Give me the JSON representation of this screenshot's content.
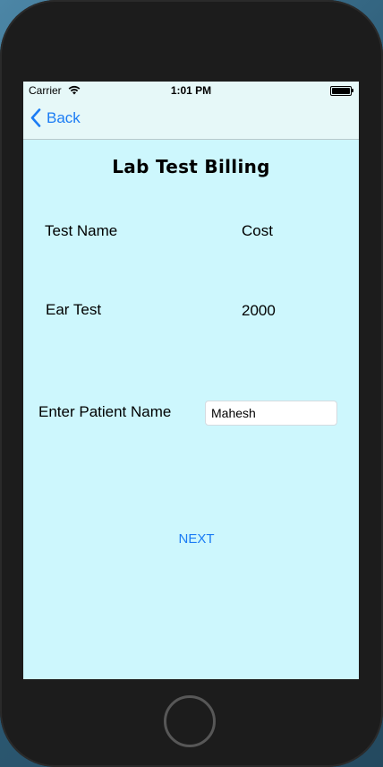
{
  "status_bar": {
    "carrier": "Carrier",
    "time": "1:01 PM",
    "wifi_icon": "wifi-icon",
    "battery_icon": "battery-full-icon"
  },
  "nav": {
    "back_label": "Back",
    "back_icon": "chevron-left-icon",
    "accent_color": "#1b7cf4"
  },
  "page": {
    "title": "Lab Test Billing",
    "background_color": "#cdf7fd"
  },
  "table": {
    "headers": [
      "Test Name",
      "Cost"
    ],
    "rows": [
      {
        "test_name": "Ear Test",
        "cost": "2000"
      }
    ]
  },
  "patient": {
    "label": "Enter Patient Name",
    "value": "Mahesh"
  },
  "actions": {
    "next_label": "NEXT"
  }
}
